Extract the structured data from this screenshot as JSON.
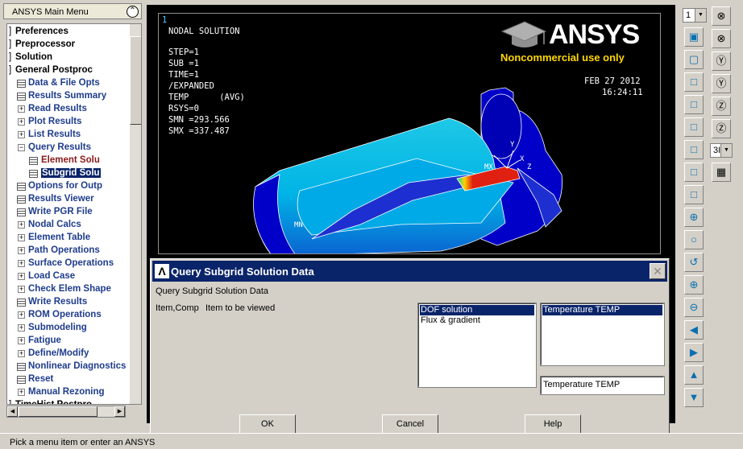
{
  "menu": {
    "title": "ANSYS Main Menu",
    "items": [
      {
        "label": "Preferences",
        "kind": "top"
      },
      {
        "label": "Preprocessor",
        "kind": "top"
      },
      {
        "label": "Solution",
        "kind": "top"
      },
      {
        "label": "General Postproc",
        "kind": "top"
      },
      {
        "label": "Data & File Opts",
        "kind": "leaf"
      },
      {
        "label": "Results Summary",
        "kind": "leaf"
      },
      {
        "label": "Read Results",
        "kind": "branch"
      },
      {
        "label": "Plot Results",
        "kind": "branch"
      },
      {
        "label": "List Results",
        "kind": "branch"
      },
      {
        "label": "Query Results",
        "kind": "open"
      },
      {
        "label": "Element Solu",
        "kind": "subleaf"
      },
      {
        "label": "Subgrid Solu",
        "kind": "subleaf"
      },
      {
        "label": "Options for Outp",
        "kind": "leaf"
      },
      {
        "label": "Results Viewer",
        "kind": "leaf"
      },
      {
        "label": "Write PGR File",
        "kind": "leaf"
      },
      {
        "label": "Nodal Calcs",
        "kind": "branch"
      },
      {
        "label": "Element Table",
        "kind": "branch"
      },
      {
        "label": "Path Operations",
        "kind": "branch"
      },
      {
        "label": "Surface Operations",
        "kind": "branch"
      },
      {
        "label": "Load Case",
        "kind": "branch"
      },
      {
        "label": "Check Elem Shape",
        "kind": "branch"
      },
      {
        "label": "Write Results",
        "kind": "leaf"
      },
      {
        "label": "ROM Operations",
        "kind": "branch"
      },
      {
        "label": "Submodeling",
        "kind": "branch"
      },
      {
        "label": "Fatigue",
        "kind": "branch"
      },
      {
        "label": "Define/Modify",
        "kind": "branch"
      },
      {
        "label": "Nonlinear Diagnostics",
        "kind": "leaf"
      },
      {
        "label": "Reset",
        "kind": "leaf"
      },
      {
        "label": "Manual Rezoning",
        "kind": "branch"
      },
      {
        "label": "TimeHist Postpro",
        "kind": "top"
      }
    ]
  },
  "graphics": {
    "window_number": "1",
    "solution_lines": [
      "NODAL SOLUTION",
      "",
      "STEP=1",
      "SUB =1",
      "TIME=1",
      "/EXPANDED",
      "TEMP      (AVG)",
      "RSYS=0",
      "SMN =293.566",
      "SMX =337.487"
    ],
    "date": "FEB 27 2012",
    "time": "16:24:11",
    "logo_text": "ANSYS",
    "logo_subtext": "Noncommercial use only",
    "label_mn": "MN",
    "label_mx": "MX",
    "axis_x": "X",
    "axis_y": "Y",
    "axis_z": "Z",
    "colors": {
      "model_light": "#1ec8e6",
      "model_mid": "#00a0e0",
      "model_dark": "#0000c8",
      "hot": "#e02010",
      "background": "#000000",
      "logo": "#ffd700"
    }
  },
  "toolbar": {
    "window_select": "1",
    "view_select": "3I",
    "icons": [
      "isometric-view-icon",
      "oblique-view-icon",
      "front-view-icon",
      "back-view-icon",
      "top-view-icon",
      "bottom-view-icon",
      "left-view-icon",
      "right-view-icon",
      "zoom-in-icon",
      "zoom-icon",
      "zoom-back-icon",
      "magnify-icon",
      "demagnify-icon",
      "pan-left-icon",
      "pan-right-icon",
      "pan-up-icon",
      "pan-down-icon",
      "rotate-x-plus-icon",
      "rotate-x-minus-icon",
      "rotate-y-plus-icon",
      "rotate-y-minus-icon",
      "rotate-z-plus-icon",
      "rotate-z-minus-icon",
      "dynamic-mode-icon"
    ]
  },
  "dialog": {
    "title": "Query Subgrid Solution Data",
    "heading": "Query Subgrid Solution Data",
    "field_code": "Item,Comp",
    "field_label": "Item to be viewed",
    "categories": [
      "DOF solution",
      "Flux & gradient"
    ],
    "components": [
      "Temperature TEMP"
    ],
    "selected_value": "Temperature TEMP",
    "ok_label": "OK",
    "cancel_label": "Cancel",
    "help_label": "Help"
  },
  "status": {
    "prompt": "Pick a menu item or enter an ANSYS"
  }
}
